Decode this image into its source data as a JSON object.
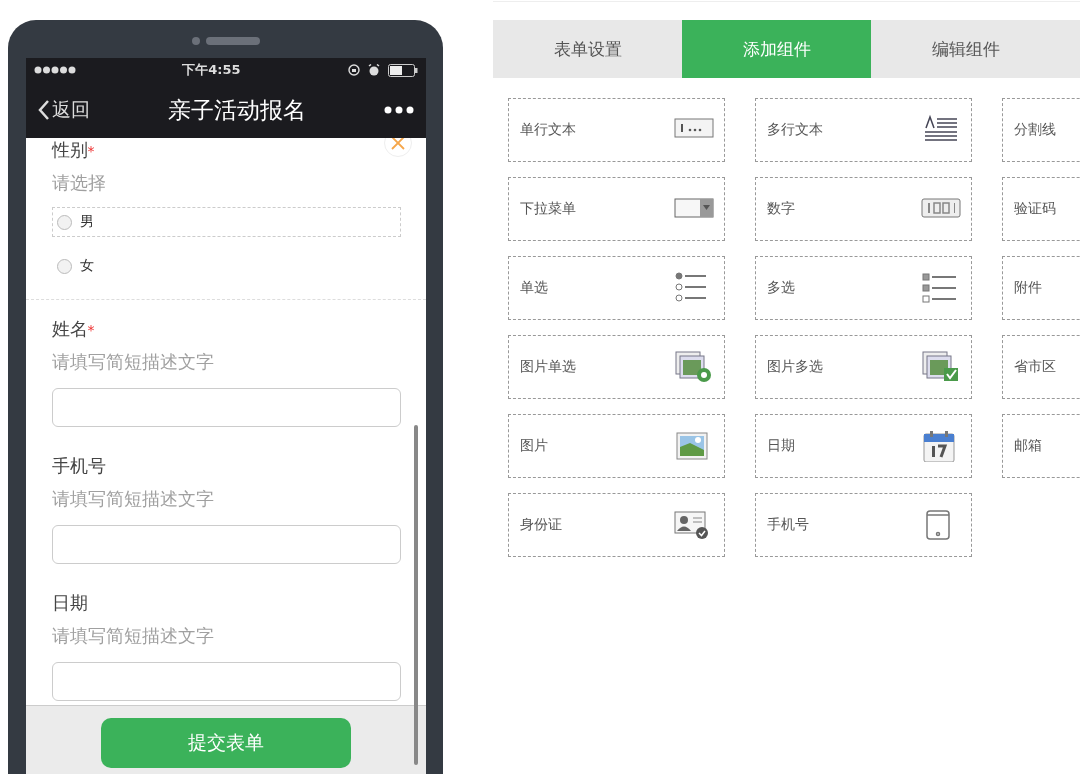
{
  "phone": {
    "status_bar": {
      "time": "下午4:55"
    },
    "nav": {
      "back": "返回",
      "title": "亲子活动报名"
    },
    "fields": [
      {
        "kind": "radio",
        "label": "性别",
        "required": true,
        "hint": "请选择",
        "active": true,
        "options": [
          {
            "label": "男",
            "checked": false,
            "outlined": true
          },
          {
            "label": "女",
            "checked": false,
            "outlined": false
          }
        ]
      },
      {
        "kind": "input",
        "label": "姓名",
        "required": true,
        "hint": "请填写简短描述文字",
        "active": false
      },
      {
        "kind": "input",
        "label": "手机号",
        "required": false,
        "hint": "请填写简短描述文字",
        "active": false
      },
      {
        "kind": "input",
        "label": "日期",
        "required": false,
        "hint": "请填写简短描述文字",
        "active": false
      }
    ],
    "submit": "提交表单",
    "required_mark": "*"
  },
  "tabs": [
    {
      "label": "表单设置",
      "selected": false
    },
    {
      "label": "添加组件",
      "selected": true
    },
    {
      "label": "编辑组件",
      "selected": false
    }
  ],
  "components": [
    {
      "label": "单行文本",
      "kind": "text"
    },
    {
      "label": "多行文本",
      "kind": "textarea"
    },
    {
      "label": "分割线"
    },
    {
      "label": "下拉菜单",
      "kind": "select"
    },
    {
      "label": "数字",
      "kind": "number"
    },
    {
      "label": "验证码"
    },
    {
      "label": "单选",
      "kind": "radio"
    },
    {
      "label": "多选",
      "kind": "checkbox"
    },
    {
      "label": "附件"
    },
    {
      "label": "图片单选",
      "kind": "image-radio"
    },
    {
      "label": "图片多选",
      "kind": "image-checkbox"
    },
    {
      "label": "省市区"
    },
    {
      "label": "图片",
      "kind": "image"
    },
    {
      "label": "日期",
      "kind": "date"
    },
    {
      "label": "邮箱"
    },
    {
      "label": "身份证",
      "kind": "id-card"
    },
    {
      "label": "手机号",
      "kind": "phone"
    }
  ]
}
